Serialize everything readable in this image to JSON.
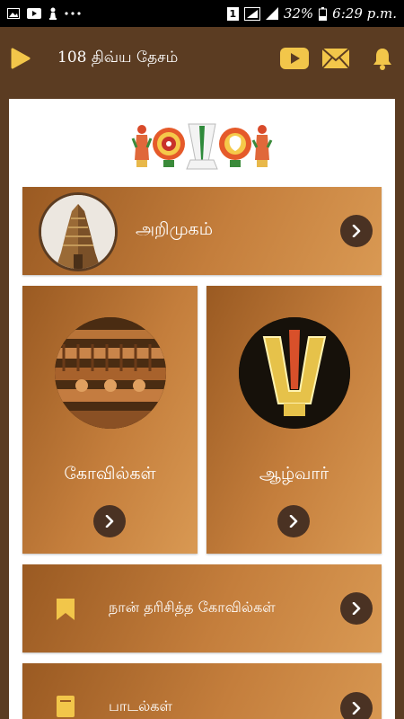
{
  "status_bar": {
    "sim_badge": "1",
    "battery": "32%",
    "time": "6:29 p.m."
  },
  "app_bar": {
    "title": "108 திவ்ய தேசம்"
  },
  "menu": {
    "intro": {
      "label": "அறிமுகம்"
    },
    "temples": {
      "label": "கோவில்கள்"
    },
    "alwar": {
      "label": "ஆழ்வார்"
    },
    "visited": {
      "label": "நான் தரிசித்த கோவில்கள்"
    },
    "songs": {
      "label": "பாடல்கள்"
    }
  },
  "colors": {
    "app_bar": "#5b3c22",
    "accent_icon": "#f2c64a",
    "card_dark": "#9a5a22",
    "card_light": "#d99953",
    "arrow_button": "#4a3223"
  }
}
